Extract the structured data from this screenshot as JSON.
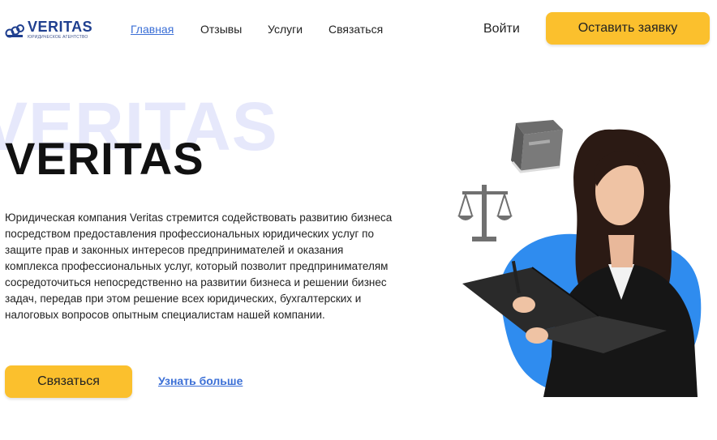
{
  "header": {
    "logo_name": "VERITAS",
    "logo_subtitle": "ЮРИДИЧЕСКОЕ АГЕНТСТВО",
    "nav": [
      {
        "label": "Главная",
        "active": true
      },
      {
        "label": "Отзывы",
        "active": false
      },
      {
        "label": "Услуги",
        "active": false
      },
      {
        "label": "Связаться",
        "active": false
      }
    ],
    "login_label": "Войти",
    "cta_label": "Оставить заявку"
  },
  "hero": {
    "background_word": "VERITAS",
    "title": "VERITAS",
    "description": "Юридическая компания Veritas стремится содействовать развитию бизнеса посредством предоставления профессиональных юридических услуг по защите прав и законных интересов предпринимателей и оказания комплекса профессиональных услуг, который позволит предпринимателям сосредоточиться непосредственно на развитии бизнеса и решении бизнес задач, передав при этом решение всех юридических, бухгалтерских и налоговых вопросов опытным специалистам нашей компании.",
    "contact_button": "Связаться",
    "more_link": "Узнать больше"
  },
  "colors": {
    "accent_yellow": "#fbc02d",
    "link_blue": "#3b6fd6",
    "logo_blue": "#1f3f8f",
    "bg_word": "#e6e8fb",
    "blob_blue": "#2f8cef"
  },
  "icons": [
    "logo-icon",
    "book-icon",
    "scales-icon"
  ]
}
